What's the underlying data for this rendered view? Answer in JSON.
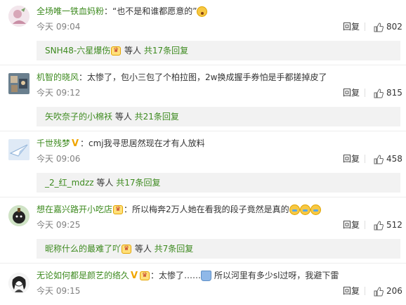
{
  "comments": [
    {
      "user": "全场唯一铁血妈粉",
      "text": "：“也不是和谁都愿意的”",
      "time": "今天 09:04",
      "reply_label": "回复",
      "likes": "802",
      "sub_user": "SNH48-六星爆伤",
      "sub_mid": " 等人 ",
      "sub_more": "共17条回复"
    },
    {
      "user": "机智的晓风",
      "text": "：太惨了，包小三包了个柏拉图，2w换成握手券怕是手都搓掉皮了",
      "time": "今天 09:12",
      "reply_label": "回复",
      "likes": "815",
      "sub_user": "矢吹奈子的小棉袄",
      "sub_mid": " 等人 ",
      "sub_more": "共21条回复"
    },
    {
      "user": "千世残梦",
      "text": "：cmj我寻思居然现在才有人放料",
      "time": "今天 09:06",
      "reply_label": "回复",
      "likes": "458",
      "sub_user": "_2_红_mdzz",
      "sub_mid": " 等人 ",
      "sub_more": "共17条回复"
    },
    {
      "user": "想在嘉兴路开小吃店",
      "text": "：所以梅奔2万人她在看我的段子竟然是真的",
      "time": "今天 09:25",
      "reply_label": "回复",
      "likes": "512",
      "sub_user": "昵称什么的最难了吖",
      "sub_mid": " 等人 ",
      "sub_more": "共7条回复"
    },
    {
      "user": "无论如何都是颜艺的络久",
      "text_a": "：太惨了……",
      "text_b": " 所以河里有多少sl过呀，我避下雷",
      "time": "今天 09:15",
      "reply_label": "回复",
      "likes": "206"
    }
  ],
  "icons": {
    "like": "thumbs-up-icon",
    "vip": "vip-badge-icon",
    "verified": "verified-v-icon"
  },
  "colors": {
    "username": "#3d8a1f",
    "meta": "#808080",
    "reply_bg": "#f2f2f2"
  }
}
